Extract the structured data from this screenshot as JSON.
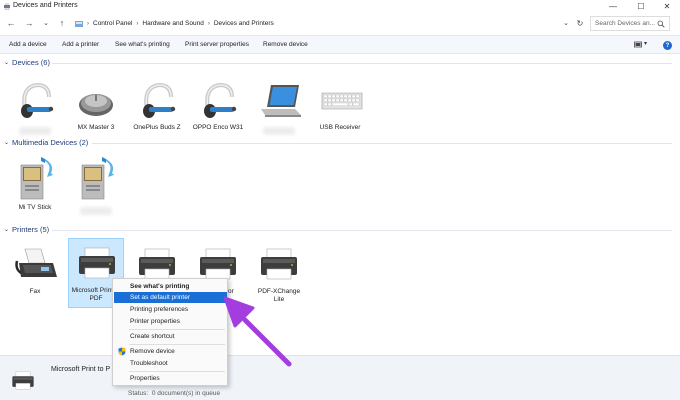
{
  "window": {
    "title": "Devices and Printers"
  },
  "titlebar": {
    "minimize": "—",
    "maximize": "☐",
    "close": "✕"
  },
  "nav": {
    "back": "←",
    "forward": "→",
    "down": "⌄",
    "up": "↑",
    "breadcrumbs": [
      "Control Panel",
      "Hardware and Sound",
      "Devices and Printers"
    ],
    "dropdown": "⌄",
    "refresh": "↻"
  },
  "search": {
    "placeholder": "Search Devices an..."
  },
  "toolbar": {
    "add_device": "Add a device",
    "add_printer": "Add a printer",
    "see_printing": "See what's printing",
    "print_server": "Print server properties",
    "remove_device": "Remove device",
    "view": "▾",
    "help": "?"
  },
  "groups": {
    "devices": {
      "label": "Devices (6)",
      "items": [
        "",
        "MX Master 3",
        "OnePlus Buds Z",
        "OPPO Enco W31",
        "",
        "USB Receiver"
      ]
    },
    "multimedia": {
      "label": "Multimedia Devices (2)",
      "items": [
        "Mi TV Stick",
        ""
      ]
    },
    "printers": {
      "label": "Printers (5)",
      "items": [
        "Fax",
        "Microsoft Print to PDF",
        "",
        "for",
        "PDF-XChange Lite"
      ]
    }
  },
  "status": {
    "name": "Microsoft Print to P",
    "model": "",
    "status_label": "Status:",
    "status_value": "0 document(s) in queue"
  },
  "context_menu": {
    "items": [
      "See what's printing",
      "Set as default printer",
      "Printing preferences",
      "Printer properties",
      "Create shortcut",
      "Remove device",
      "Troubleshoot",
      "Properties"
    ]
  },
  "colors": {
    "accent": "#1a6fd6",
    "annotation_arrow": "#a33de0",
    "selection": "#cce8ff"
  }
}
